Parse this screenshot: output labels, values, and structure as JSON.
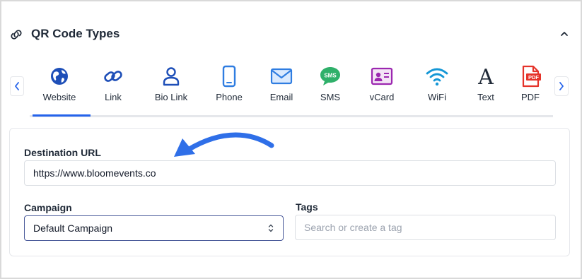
{
  "header": {
    "title": "QR Code Types"
  },
  "types": {
    "items": [
      {
        "label": "Website",
        "icon": "globe-icon",
        "active": true
      },
      {
        "label": "Link",
        "icon": "link-icon"
      },
      {
        "label": "Bio Link",
        "icon": "person-icon"
      },
      {
        "label": "Phone",
        "icon": "phone-icon"
      },
      {
        "label": "Email",
        "icon": "email-icon"
      },
      {
        "label": "SMS",
        "icon": "sms-icon"
      },
      {
        "label": "vCard",
        "icon": "vcard-icon"
      },
      {
        "label": "WiFi",
        "icon": "wifi-icon"
      },
      {
        "label": "Text",
        "icon": "text-icon"
      },
      {
        "label": "PDF",
        "icon": "pdf-icon"
      }
    ]
  },
  "form": {
    "destination_label": "Destination URL",
    "destination_value": "https://www.bloomevents.co",
    "campaign_label": "Campaign",
    "campaign_value": "Default Campaign",
    "tags_label": "Tags",
    "tags_placeholder": "Search or create a tag"
  },
  "colors": {
    "accent": "#2563eb",
    "annotation_arrow": "#2f6fe8",
    "sms": "#22a45d",
    "vcard": "#9c27b0",
    "wifi": "#1597d6",
    "pdf": "#e5332a",
    "globe": "#1e4fb8"
  }
}
